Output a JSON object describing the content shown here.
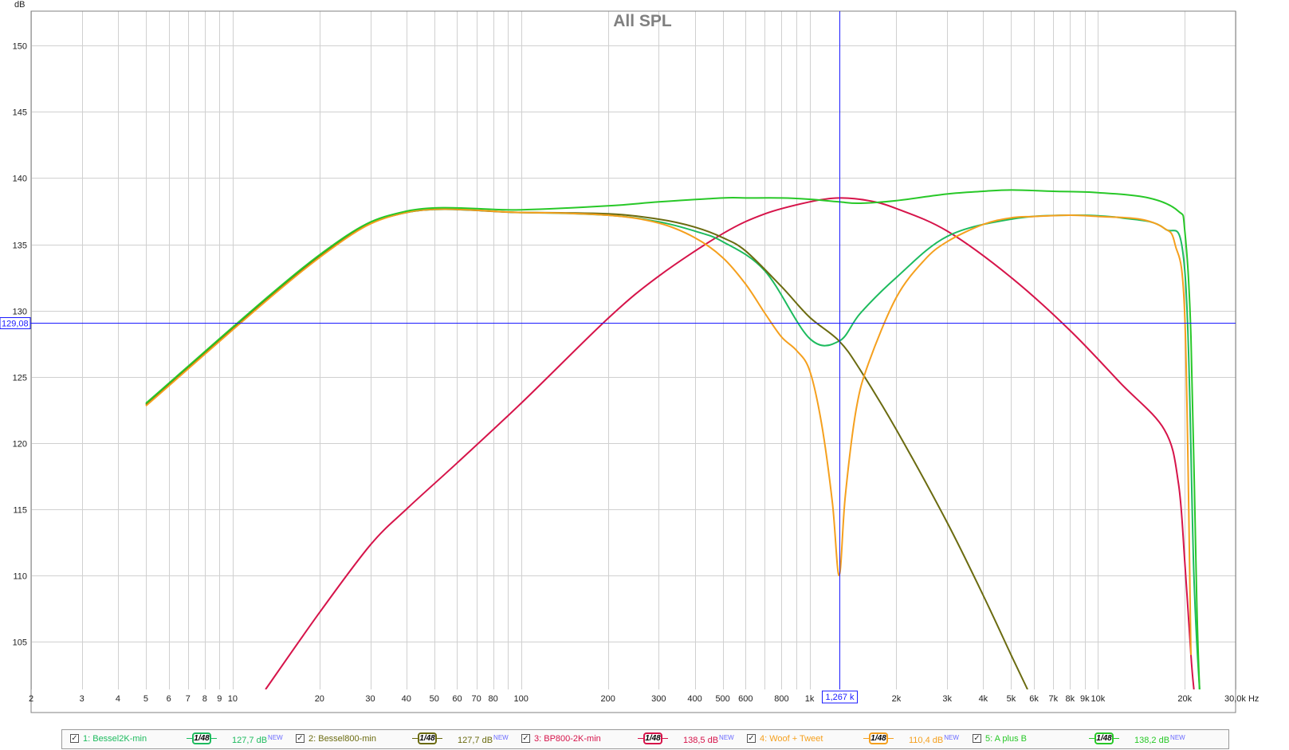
{
  "chart_data": {
    "type": "line",
    "title": "All SPL",
    "ylabel": "dB",
    "xlabel": "Hz",
    "xscale": "log",
    "xlim": [
      2,
      30000
    ],
    "ylim": [
      101.4,
      152.6
    ],
    "grid": true,
    "y_ticks": [
      "105",
      "110",
      "115",
      "120",
      "125",
      "130",
      "135",
      "140",
      "145",
      "150"
    ],
    "x_tick_labels": [
      {
        "f": 2,
        "label": "2"
      },
      {
        "f": 3,
        "label": "3"
      },
      {
        "f": 4,
        "label": "4"
      },
      {
        "f": 5,
        "label": "5"
      },
      {
        "f": 6,
        "label": "6"
      },
      {
        "f": 7,
        "label": "7"
      },
      {
        "f": 8,
        "label": "8"
      },
      {
        "f": 9,
        "label": "9"
      },
      {
        "f": 10,
        "label": "10"
      },
      {
        "f": 20,
        "label": "20"
      },
      {
        "f": 30,
        "label": "30"
      },
      {
        "f": 40,
        "label": "40"
      },
      {
        "f": 50,
        "label": "50"
      },
      {
        "f": 60,
        "label": "60"
      },
      {
        "f": 70,
        "label": "70"
      },
      {
        "f": 80,
        "label": "80"
      },
      {
        "f": 100,
        "label": "100"
      },
      {
        "f": 200,
        "label": "200"
      },
      {
        "f": 300,
        "label": "300"
      },
      {
        "f": 400,
        "label": "400"
      },
      {
        "f": 500,
        "label": "500"
      },
      {
        "f": 600,
        "label": "600"
      },
      {
        "f": 800,
        "label": "800"
      },
      {
        "f": 1000,
        "label": "1k"
      },
      {
        "f": 2000,
        "label": "2k"
      },
      {
        "f": 3000,
        "label": "3k"
      },
      {
        "f": 4000,
        "label": "4k"
      },
      {
        "f": 5000,
        "label": "5k"
      },
      {
        "f": 6000,
        "label": "6k"
      },
      {
        "f": 7000,
        "label": "7k"
      },
      {
        "f": 8000,
        "label": "8k"
      },
      {
        "f": 9000,
        "label": "9k"
      },
      {
        "f": 10000,
        "label": "10k"
      },
      {
        "f": 20000,
        "label": "20k"
      },
      {
        "f": 30000,
        "label": "30,0k Hz"
      }
    ],
    "cursor": {
      "x": 1267,
      "y": 129.08,
      "x_label": "1,267 k",
      "y_label": "129,08"
    },
    "series": [
      {
        "name": "1: Bessel2K-min",
        "color": "#1dbb5e",
        "smoothing": "1/48",
        "value": "127,7 dB",
        "x": [
          5,
          20,
          40,
          100,
          200,
          300,
          400,
          500,
          700,
          1000,
          1267,
          1500,
          2000,
          3000,
          5000,
          8000,
          12000,
          17000,
          20000,
          21500,
          22500
        ],
        "y": [
          122.9,
          134.1,
          137.4,
          137.4,
          137.2,
          136.7,
          136.0,
          135.2,
          133.0,
          127.9,
          127.7,
          129.8,
          132.5,
          135.6,
          136.9,
          137.2,
          137.0,
          136.2,
          133.0,
          110.0,
          101.4
        ]
      },
      {
        "name": "2: Bessel800-min",
        "color": "#6b6b10",
        "smoothing": "1/48",
        "value": "127,7 dB",
        "x": [
          5,
          20,
          40,
          100,
          200,
          300,
          400,
          500,
          600,
          800,
          1000,
          1267,
          1500,
          2000,
          3000,
          4000,
          5000,
          5700
        ],
        "y": [
          122.9,
          134.1,
          137.4,
          137.4,
          137.3,
          136.9,
          136.3,
          135.5,
          134.5,
          131.8,
          129.5,
          127.7,
          125.5,
          121.0,
          114.0,
          108.5,
          104.0,
          101.4
        ]
      },
      {
        "name": "3: BP800-2K-min",
        "color": "#d6144a",
        "smoothing": "1/48",
        "value": "138,5 dB",
        "x": [
          13,
          20,
          30,
          40,
          60,
          100,
          200,
          300,
          500,
          700,
          1000,
          1267,
          1600,
          2000,
          3000,
          5000,
          8000,
          12000,
          17000,
          19000,
          20000,
          21000,
          21500
        ],
        "y": [
          101.4,
          107.2,
          112.3,
          115.0,
          118.5,
          123.0,
          129.4,
          132.6,
          135.8,
          137.3,
          138.2,
          138.5,
          138.3,
          137.7,
          136.0,
          132.5,
          128.5,
          124.5,
          121.0,
          117.0,
          111.0,
          104.0,
          101.4
        ]
      },
      {
        "name": "4: Woof + Tweet",
        "color": "#f5a01e",
        "smoothing": "1/48",
        "value": "110,4 dB",
        "x": [
          5,
          20,
          40,
          100,
          200,
          300,
          400,
          500,
          600,
          700,
          800,
          900,
          1000,
          1100,
          1200,
          1267,
          1330,
          1450,
          1600,
          2000,
          2500,
          3000,
          4000,
          5000,
          6000,
          8000,
          10000,
          14000,
          17000,
          18500,
          20000,
          21000
        ],
        "y": [
          122.8,
          134.0,
          137.4,
          137.4,
          137.2,
          136.6,
          135.5,
          134.0,
          132.0,
          129.8,
          128.0,
          127.0,
          125.5,
          121.5,
          115.5,
          110.0,
          116.0,
          122.5,
          126.0,
          131.0,
          133.8,
          135.2,
          136.5,
          137.0,
          137.1,
          137.2,
          137.1,
          136.9,
          136.2,
          135.0,
          129.5,
          104.0
        ]
      },
      {
        "name": "5: A plus B",
        "color": "#28c828",
        "smoothing": "1/48",
        "value": "138,2 dB",
        "x": [
          5,
          20,
          40,
          100,
          200,
          300,
          500,
          600,
          800,
          1000,
          1267,
          1500,
          2000,
          3000,
          4000,
          5000,
          7000,
          10000,
          15000,
          19000,
          20000,
          21000,
          22000,
          22500
        ],
        "y": [
          123.0,
          134.2,
          137.5,
          137.6,
          137.9,
          138.2,
          138.5,
          138.5,
          138.5,
          138.4,
          138.2,
          138.1,
          138.3,
          138.8,
          139.0,
          139.1,
          139.0,
          138.9,
          138.5,
          137.5,
          136.0,
          128.0,
          108.0,
          101.4
        ]
      }
    ]
  }
}
